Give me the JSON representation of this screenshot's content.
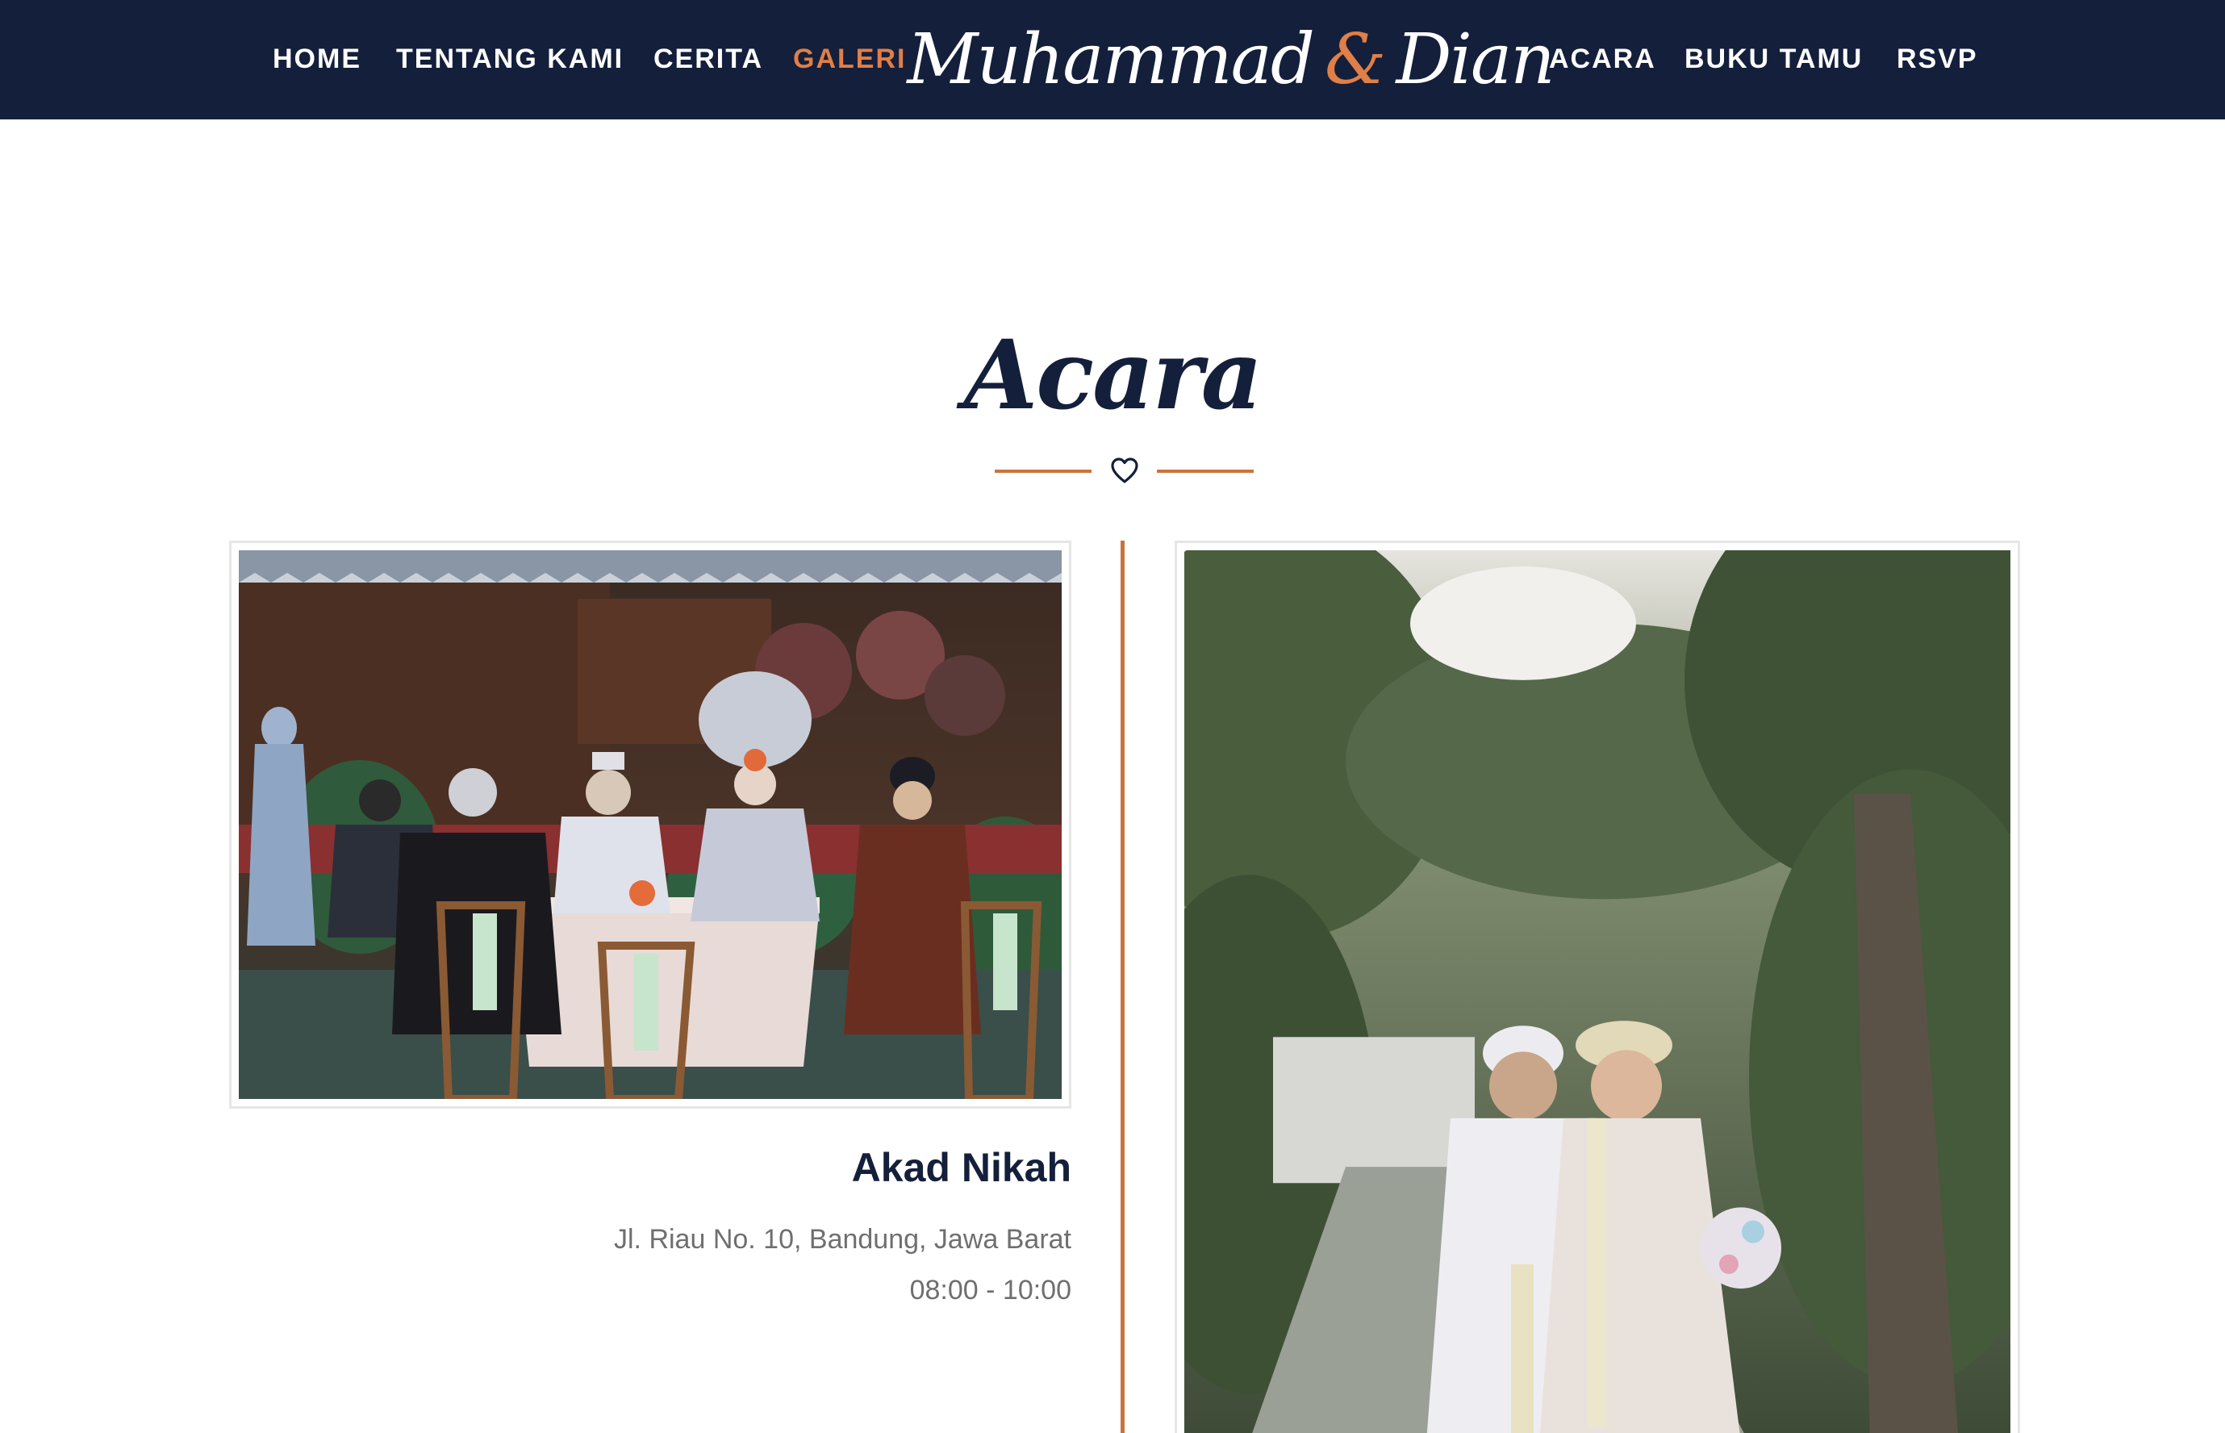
{
  "nav": {
    "left": [
      "HOME",
      "TENTANG KAMI",
      "CERITA",
      "GALERI"
    ],
    "right": [
      "ACARA",
      "BUKU TAMU",
      "RSVP"
    ],
    "active": "GALERI"
  },
  "brand": {
    "name1": "Muhammad",
    "amp": "&",
    "name2": "Dian"
  },
  "section": {
    "title": "Acara",
    "divider_icon": "heart-outline-icon"
  },
  "events": [
    {
      "title": "Akad Nikah",
      "address": "Jl. Riau No. 10, Bandung, Jawa Barat",
      "time": "08:00 - 10:00",
      "photo": "akad-ceremony-photo"
    },
    {
      "photo": "couple-garden-photo"
    }
  ],
  "colors": {
    "navy": "#141f3b",
    "accent": "#e07f47",
    "divider": "#c9743d",
    "muted_text": "#6f6f6f"
  }
}
